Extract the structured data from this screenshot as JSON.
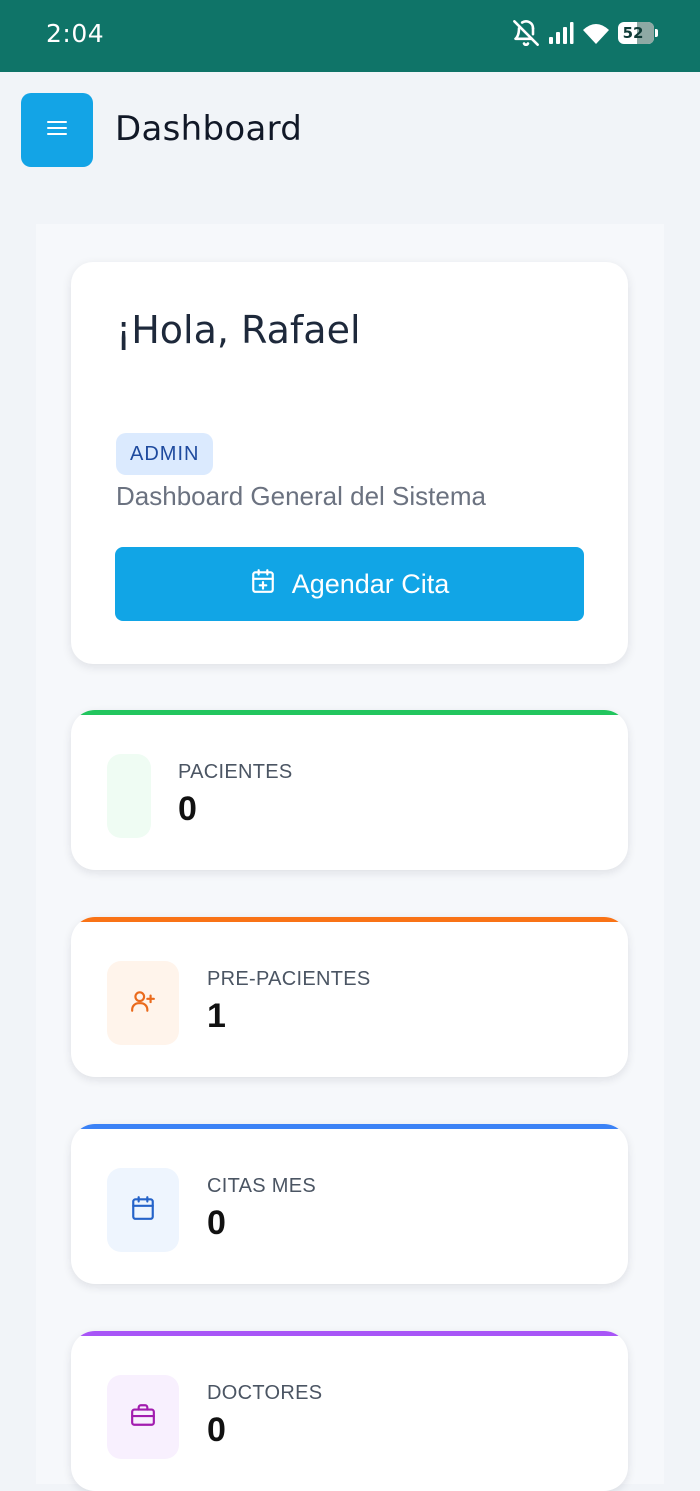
{
  "status_bar": {
    "time": "2:04",
    "battery_percent": "52",
    "battery_level": 0.52,
    "icons": [
      "bell-off-icon",
      "signal-icon",
      "wifi-icon",
      "battery-icon"
    ]
  },
  "header": {
    "title": "Dashboard",
    "menu_icon": "hamburger-menu-icon"
  },
  "welcome": {
    "greeting": "¡Hola, Rafael",
    "role": "ADMIN",
    "subtitle": "Dashboard General del Sistema",
    "cta_label": "Agendar Cita",
    "cta_icon": "calendar-plus-icon"
  },
  "stats": [
    {
      "label": "PACIENTES",
      "value": "0",
      "accent": "#22c55e",
      "icon": "none"
    },
    {
      "label": "PRE-PACIENTES",
      "value": "1",
      "accent": "#f97316",
      "icon": "user-plus-icon"
    },
    {
      "label": "CITAS MES",
      "value": "0",
      "accent": "#3b82f6",
      "icon": "calendar-icon"
    },
    {
      "label": "DOCTORES",
      "value": "0",
      "accent": "#a855f7",
      "icon": "briefcase-icon"
    }
  ],
  "colors": {
    "status_bar": "#0f7468",
    "primary": "#13a4e6",
    "background": "#f1f4f8"
  }
}
